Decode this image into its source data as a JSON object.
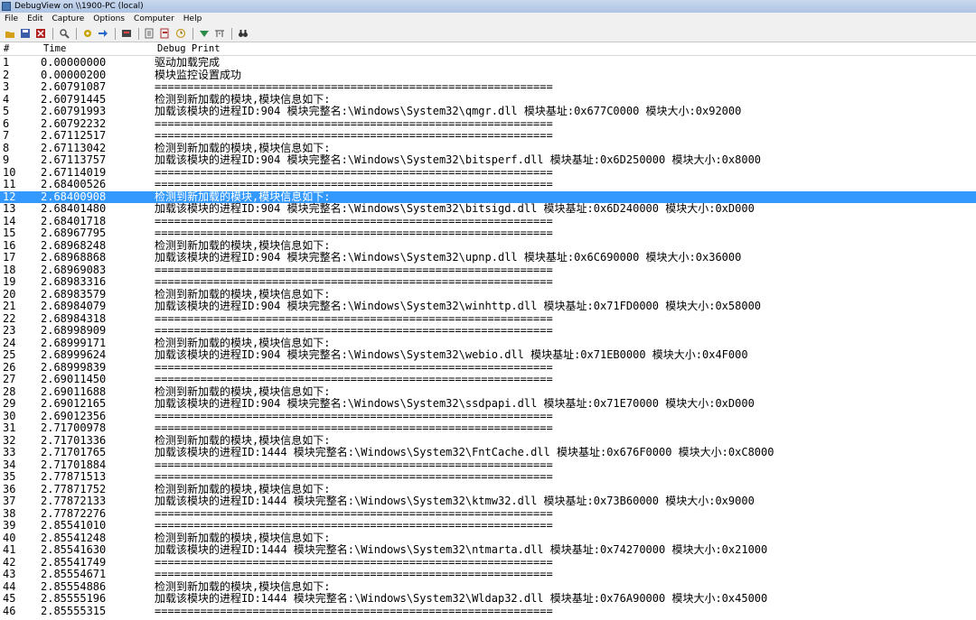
{
  "window": {
    "title": "DebugView on \\\\1900-PC (local)"
  },
  "menu": [
    "File",
    "Edit",
    "Capture",
    "Options",
    "Computer",
    "Help"
  ],
  "toolbar": [
    {
      "name": "open-icon",
      "color": "#d4a017"
    },
    {
      "name": "save-icon",
      "color": "#3a5fa8"
    },
    {
      "name": "clear-icon",
      "color": "#b02020"
    },
    {
      "sep": true
    },
    {
      "name": "find-icon",
      "color": "#555555"
    },
    {
      "sep": true
    },
    {
      "name": "capture-icon",
      "color": "#c9a400"
    },
    {
      "name": "autoscroll-icon",
      "color": "#2a68c8"
    },
    {
      "sep": true
    },
    {
      "name": "capture-kernel-icon",
      "color": "#444444"
    },
    {
      "sep": true
    },
    {
      "name": "filter-icon",
      "color": "#666666"
    },
    {
      "name": "highlight-icon",
      "color": "#b03030"
    },
    {
      "name": "clock-icon",
      "color": "#c89a20"
    },
    {
      "sep": true
    },
    {
      "name": "connect-icon",
      "color": "#2a8a4a"
    },
    {
      "name": "history-icon",
      "color": "#666666"
    },
    {
      "sep": true
    },
    {
      "name": "binoculars-icon",
      "color": "#333333"
    }
  ],
  "columns": [
    "#",
    "Time",
    "Debug Print"
  ],
  "selected_row": 12,
  "rows": [
    [
      "1",
      "0.00000000",
      "驱动加载完成"
    ],
    [
      "2",
      "0.00000200",
      "模块监控设置成功"
    ],
    [
      "3",
      "2.60791087",
      "============================================================="
    ],
    [
      "4",
      "2.60791445",
      "检测到新加载的模块,模块信息如下:"
    ],
    [
      "5",
      "2.60791993",
      "加载该模块的进程ID:904 模块完整名:\\Windows\\System32\\qmgr.dll 模块基址:0x677C0000 模块大小:0x92000"
    ],
    [
      "6",
      "2.60792232",
      "============================================================="
    ],
    [
      "7",
      "2.67112517",
      "============================================================="
    ],
    [
      "8",
      "2.67113042",
      "检测到新加载的模块,模块信息如下:"
    ],
    [
      "9",
      "2.67113757",
      "加载该模块的进程ID:904 模块完整名:\\Windows\\System32\\bitsperf.dll 模块基址:0x6D250000 模块大小:0x8000"
    ],
    [
      "10",
      "2.67114019",
      "============================================================="
    ],
    [
      "11",
      "2.68400526",
      "============================================================="
    ],
    [
      "12",
      "2.68400908",
      "检测到新加载的模块,模块信息如下:"
    ],
    [
      "13",
      "2.68401480",
      "加载该模块的进程ID:904 模块完整名:\\Windows\\System32\\bitsigd.dll 模块基址:0x6D240000 模块大小:0xD000"
    ],
    [
      "14",
      "2.68401718",
      "============================================================="
    ],
    [
      "15",
      "2.68967795",
      "============================================================="
    ],
    [
      "16",
      "2.68968248",
      "检测到新加载的模块,模块信息如下:"
    ],
    [
      "17",
      "2.68968868",
      "加载该模块的进程ID:904 模块完整名:\\Windows\\System32\\upnp.dll 模块基址:0x6C690000 模块大小:0x36000"
    ],
    [
      "18",
      "2.68969083",
      "============================================================="
    ],
    [
      "19",
      "2.68983316",
      "============================================================="
    ],
    [
      "20",
      "2.68983579",
      "检测到新加载的模块,模块信息如下:"
    ],
    [
      "21",
      "2.68984079",
      "加载该模块的进程ID:904 模块完整名:\\Windows\\System32\\winhttp.dll 模块基址:0x71FD0000 模块大小:0x58000"
    ],
    [
      "22",
      "2.68984318",
      "============================================================="
    ],
    [
      "23",
      "2.68998909",
      "============================================================="
    ],
    [
      "24",
      "2.68999171",
      "检测到新加载的模块,模块信息如下:"
    ],
    [
      "25",
      "2.68999624",
      "加载该模块的进程ID:904 模块完整名:\\Windows\\System32\\webio.dll 模块基址:0x71EB0000 模块大小:0x4F000"
    ],
    [
      "26",
      "2.68999839",
      "============================================================="
    ],
    [
      "27",
      "2.69011450",
      "============================================================="
    ],
    [
      "28",
      "2.69011688",
      "检测到新加载的模块,模块信息如下:"
    ],
    [
      "29",
      "2.69012165",
      "加载该模块的进程ID:904 模块完整名:\\Windows\\System32\\ssdpapi.dll 模块基址:0x71E70000 模块大小:0xD000"
    ],
    [
      "30",
      "2.69012356",
      "============================================================="
    ],
    [
      "31",
      "2.71700978",
      "============================================================="
    ],
    [
      "32",
      "2.71701336",
      "检测到新加载的模块,模块信息如下:"
    ],
    [
      "33",
      "2.71701765",
      "加载该模块的进程ID:1444 模块完整名:\\Windows\\System32\\FntCache.dll 模块基址:0x676F0000 模块大小:0xC8000"
    ],
    [
      "34",
      "2.71701884",
      "============================================================="
    ],
    [
      "35",
      "2.77871513",
      "============================================================="
    ],
    [
      "36",
      "2.77871752",
      "检测到新加载的模块,模块信息如下:"
    ],
    [
      "37",
      "2.77872133",
      "加载该模块的进程ID:1444 模块完整名:\\Windows\\System32\\ktmw32.dll 模块基址:0x73B60000 模块大小:0x9000"
    ],
    [
      "38",
      "2.77872276",
      "============================================================="
    ],
    [
      "39",
      "2.85541010",
      "============================================================="
    ],
    [
      "40",
      "2.85541248",
      "检测到新加载的模块,模块信息如下:"
    ],
    [
      "41",
      "2.85541630",
      "加载该模块的进程ID:1444 模块完整名:\\Windows\\System32\\ntmarta.dll 模块基址:0x74270000 模块大小:0x21000"
    ],
    [
      "42",
      "2.85541749",
      "============================================================="
    ],
    [
      "43",
      "2.85554671",
      "============================================================="
    ],
    [
      "44",
      "2.85554886",
      "检测到新加载的模块,模块信息如下:"
    ],
    [
      "45",
      "2.85555196",
      "加载该模块的进程ID:1444 模块完整名:\\Windows\\System32\\Wldap32.dll 模块基址:0x76A90000 模块大小:0x45000"
    ],
    [
      "46",
      "2.85555315",
      "============================================================="
    ]
  ]
}
